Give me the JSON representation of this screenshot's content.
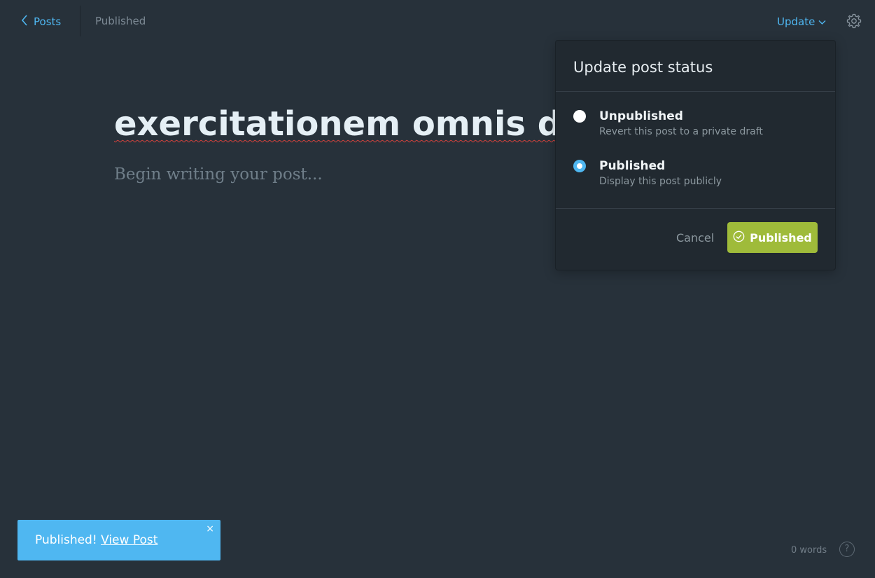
{
  "header": {
    "back_label": "Posts",
    "status": "Published",
    "update_label": "Update"
  },
  "editor": {
    "title": "exercitationem omnis d",
    "body_placeholder": "Begin writing your post..."
  },
  "status_panel": {
    "heading": "Update post status",
    "options": [
      {
        "title": "Unpublished",
        "description": "Revert this post to a private draft",
        "selected": false
      },
      {
        "title": "Published",
        "description": "Display this post publicly",
        "selected": true
      }
    ],
    "cancel_label": "Cancel",
    "confirm_label": "Published"
  },
  "toast": {
    "message": "Published!",
    "link_label": "View Post",
    "close_glyph": "×"
  },
  "footer": {
    "word_count": "0 words",
    "help_glyph": "?"
  },
  "icons": {
    "back": "chevron-left-icon",
    "update": "chevron-down-icon",
    "settings": "gear-icon",
    "confirm": "check-circle-icon"
  },
  "colors": {
    "background": "#27313a",
    "accent": "#4fb7f1",
    "publish_green": "#9fbb3a",
    "panel": "#212930"
  }
}
